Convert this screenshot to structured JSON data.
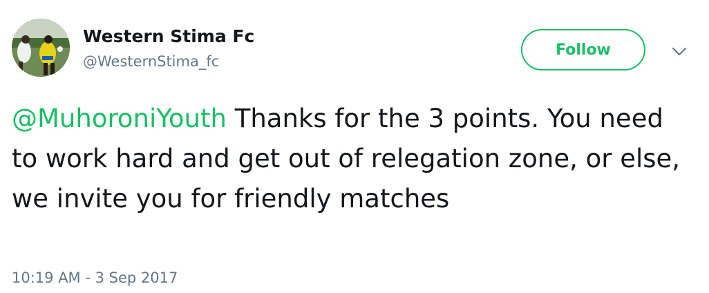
{
  "user": {
    "display_name": "Western Stima Fc",
    "handle": "@WesternStima_fc"
  },
  "actions": {
    "follow_label": "Follow",
    "more_icon": "chevron-down-icon"
  },
  "tweet": {
    "mention": "@MuhoroniYouth",
    "body": " Thanks for the 3 points. You need to work hard and get out of relegation zone, or else, we invite you for friendly matches",
    "timestamp": "10:19 AM - 3 Sep 2017"
  },
  "colors": {
    "accent": "#17bf63",
    "text": "#14171a",
    "secondary_text": "#657786"
  }
}
